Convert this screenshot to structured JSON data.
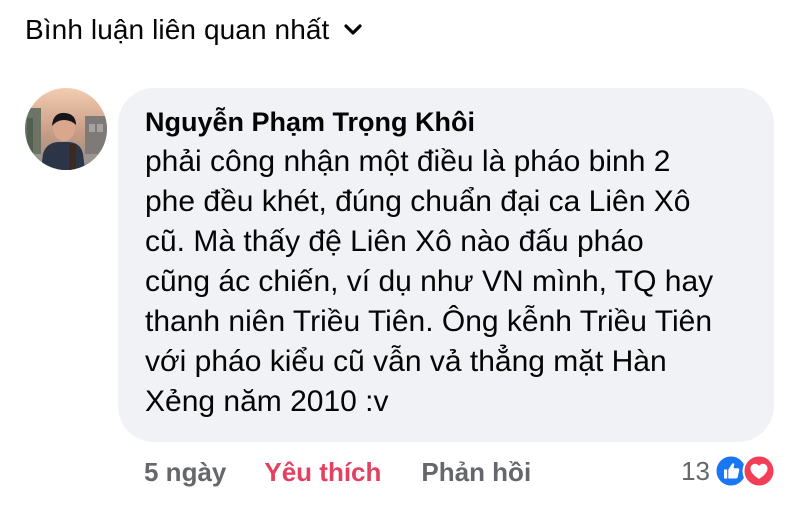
{
  "header": {
    "sort_label": "Bình luận liên quan nhất"
  },
  "comment": {
    "author": "Nguyễn Phạm Trọng Khôi",
    "lines": [
      "phải công nhận một điều là pháo binh 2",
      "phe đều khét, đúng chuẩn đại ca Liên Xô",
      "cũ. Mà thấy đệ Liên Xô nào đấu pháo",
      "cũng ác chiến, ví dụ như VN mình, TQ hay",
      "thanh niên Triều Tiên. Ông kễnh Triều Tiên",
      "với pháo kiểu cũ vẫn vả thẳng mặt Hàn",
      "Xẻng năm 2010 :v"
    ],
    "time": "5 ngày",
    "like_label": "Yêu thích",
    "reply_label": "Phản hồi",
    "reaction_count": "13",
    "reactions": [
      "like-icon",
      "love-icon"
    ]
  },
  "colors": {
    "bubble": "#f0f2f5",
    "like_active": "#e4405f",
    "secondary_text": "#65676b",
    "like_reaction": "#1877f2",
    "love_reaction": "#f33e58"
  }
}
